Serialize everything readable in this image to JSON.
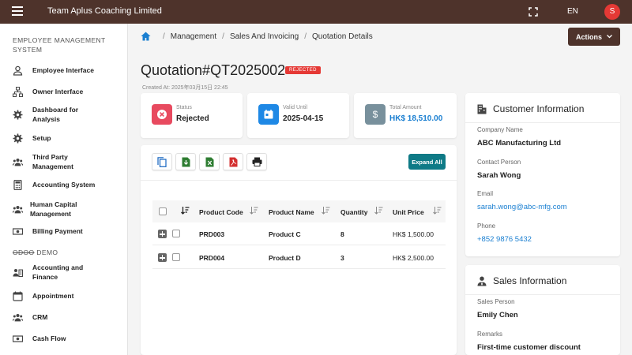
{
  "app": {
    "title": "Team Aplus Coaching Limited",
    "language": "EN",
    "avatar_initial": "S",
    "accent": "#4e332b"
  },
  "sidebar": {
    "section1": "EMPLOYEE MANAGEMENT SYSTEM",
    "items1": [
      {
        "label": "Employee Interface",
        "icon": "person-icon"
      },
      {
        "label": "Owner Interface",
        "icon": "org-chart-icon"
      },
      {
        "label": "Dashboard for Analysis",
        "icon": "gear-icon"
      },
      {
        "label": "Setup",
        "icon": "gear-icon"
      },
      {
        "label": "Third Party Management",
        "icon": "group-icon"
      },
      {
        "label": "Accounting System",
        "icon": "calculator-icon"
      },
      {
        "label": "Human Capital Management",
        "icon": "group-icon"
      },
      {
        "label": "Billing Payment",
        "icon": "money-icon"
      }
    ],
    "section2_prefix": "ODOO",
    "section2_suffix": " DEMO",
    "items2": [
      {
        "label": "Accounting and Finance",
        "icon": "finance-icon"
      },
      {
        "label": "Appointment",
        "icon": "calendar-icon"
      },
      {
        "label": "CRM",
        "icon": "group-icon"
      },
      {
        "label": "Cash Flow",
        "icon": "money-icon"
      }
    ]
  },
  "breadcrumb": [
    "Management",
    "Sales And Invoicing",
    "Quotation Details"
  ],
  "actions_label": "Actions",
  "quotation": {
    "title": "Quotation#QT2025002",
    "status_badge": "REJECTED",
    "created_at": "Created At: 2025年03月15日 22:45"
  },
  "stats": [
    {
      "label": "Status",
      "value": "Rejected",
      "color": "#e84a5f"
    },
    {
      "label": "Valid Until",
      "value": "2025-04-15",
      "color": "#1e88e5"
    },
    {
      "label": "Total Amount",
      "value": "HK$ 18,510.00",
      "color": "#78909c"
    }
  ],
  "toolbar": {
    "expand_label": "Expand All"
  },
  "table": {
    "headers": [
      "Product Code",
      "Product Name",
      "Quantity",
      "Unit Price"
    ],
    "rows": [
      {
        "code": "PRD003",
        "name": "Product C",
        "qty": "8",
        "price": "HK$ 1,500.00"
      },
      {
        "code": "PRD004",
        "name": "Product D",
        "qty": "3",
        "price": "HK$ 2,500.00"
      }
    ]
  },
  "customer": {
    "title": "Customer Information",
    "company_label": "Company Name",
    "company": "ABC Manufacturing Ltd",
    "contact_label": "Contact Person",
    "contact": "Sarah Wong",
    "email_label": "Email",
    "email": "sarah.wong@abc-mfg.com",
    "phone_label": "Phone",
    "phone": "+852 9876 5432"
  },
  "sales": {
    "title": "Sales Information",
    "person_label": "Sales Person",
    "person": "Emily Chen",
    "remarks_label": "Remarks",
    "remarks": "First-time customer discount"
  }
}
